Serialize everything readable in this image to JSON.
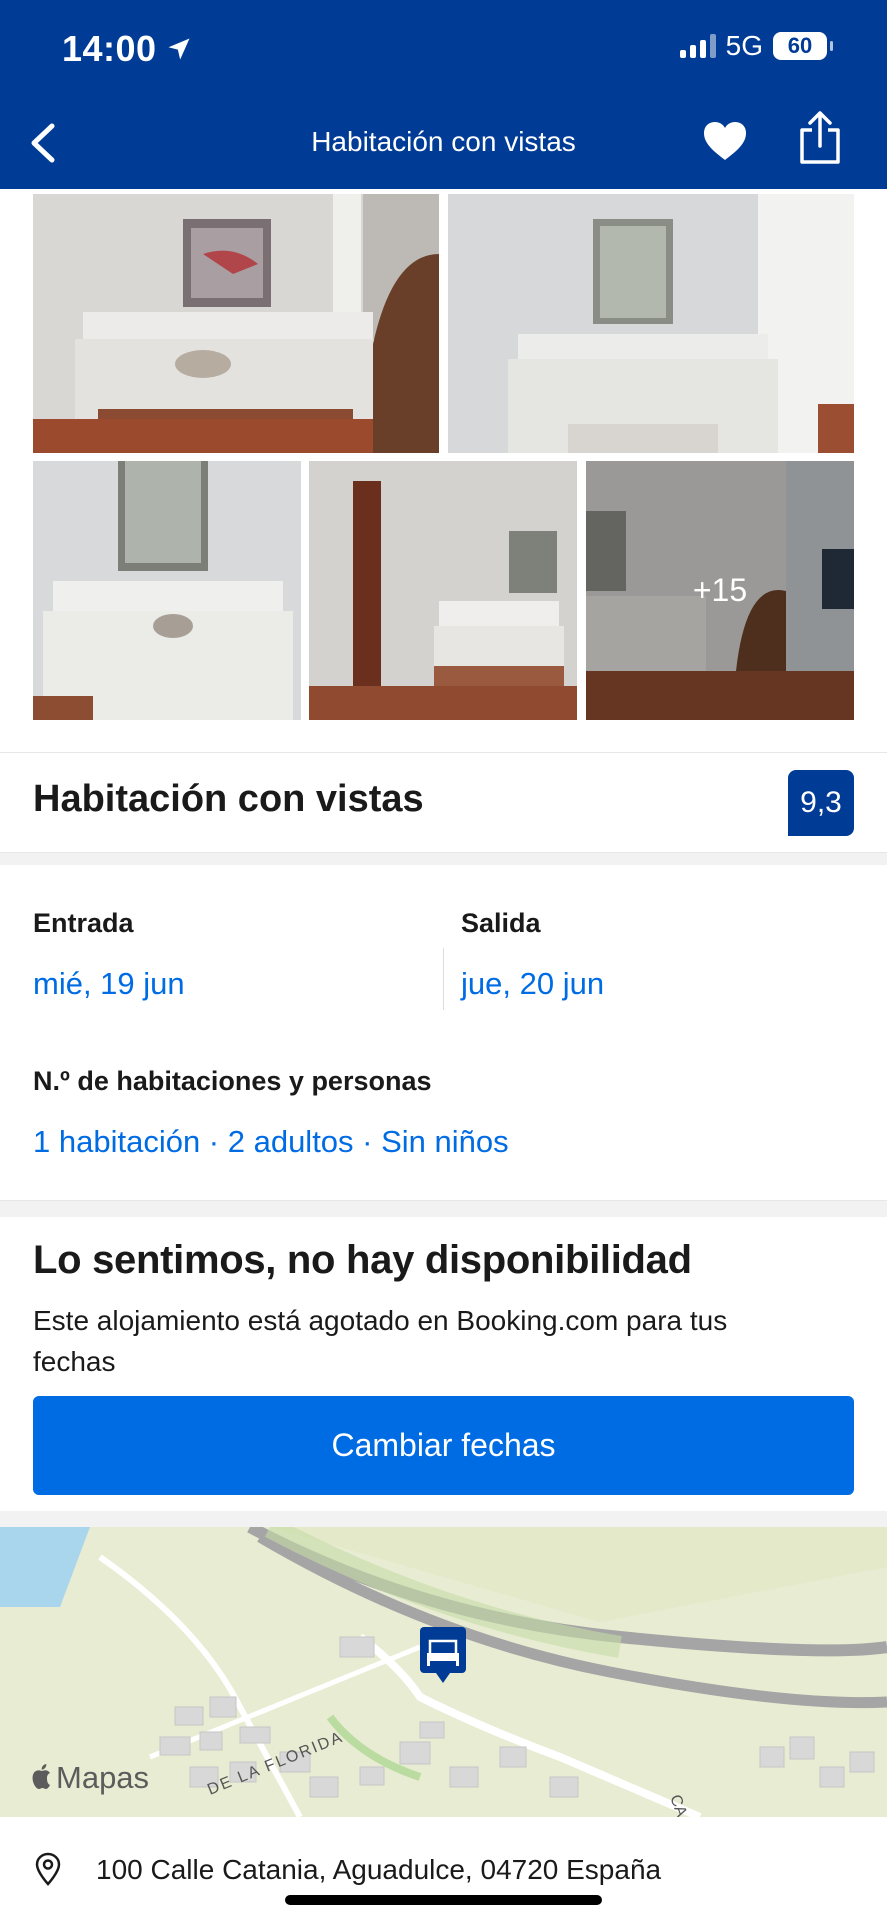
{
  "status": {
    "time": "14:00",
    "network": "5G",
    "battery": "60"
  },
  "nav": {
    "title": "Habitación con vistas"
  },
  "gallery": {
    "more_label": "+15"
  },
  "property": {
    "name": "Habitación con vistas",
    "score": "9,3"
  },
  "dates": {
    "checkin_label": "Entrada",
    "checkin_value": "mié, 19 jun",
    "checkout_label": "Salida",
    "checkout_value": "jue, 20 jun"
  },
  "guests": {
    "label": "N.º de habitaciones y personas",
    "value": "1 habitación · 2 adultos · Sin niños"
  },
  "availability": {
    "title": "Lo sentimos, no hay disponibilidad",
    "message": "Este alojamiento está agotado en Booking.com para tus fechas",
    "button_label": "Cambiar fechas"
  },
  "map": {
    "brand": "Mapas",
    "street_label": "DE LA FLORIDA",
    "street_label_2": "CA",
    "marker_icon": "hotel-bed-icon"
  },
  "address": {
    "text": "100 Calle Catania, Aguadulce, 04720 España",
    "icon": "location-pin-icon"
  },
  "colors": {
    "header": "#003b95",
    "link": "#006ce4",
    "button": "#006ce4",
    "score_bg": "#003b95"
  }
}
